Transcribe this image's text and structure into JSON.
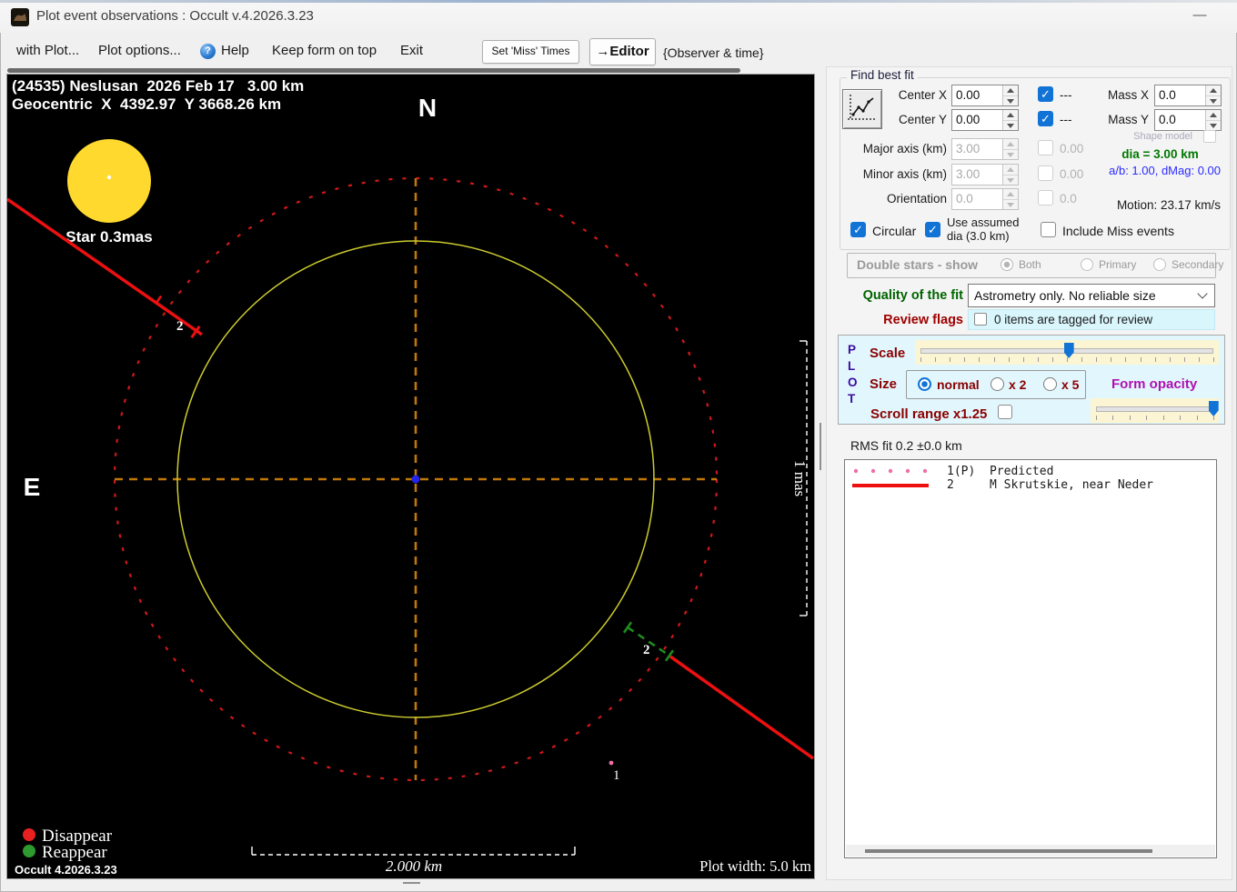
{
  "window": {
    "title": "Plot event observations : Occult v.4.2026.3.23",
    "minimize_glyph": "—"
  },
  "menubar": {
    "with_plot": "with Plot...",
    "plot_options": "Plot options...",
    "help": "Help",
    "keep_on_top": "Keep form on top",
    "exit": "Exit",
    "set_miss_times": "Set 'Miss' Times",
    "editor": "→Editor",
    "observer_time": "{Observer & time}"
  },
  "plot": {
    "header_line1": "(24535) Neslusan  2026 Feb 17   3.00 km",
    "header_line2": "Geocentric  X  4392.97  Y 3668.26 km",
    "north_label": "N",
    "east_label": "E",
    "star_label": "Star 0.3mas",
    "chord2_upper_label": "2",
    "chord2_lower_label": "2",
    "point1_label": "1",
    "legend_disappear": "Disappear",
    "legend_reappear": "Reappear",
    "version": "Occult 4.2026.3.23",
    "scale_bar_label": "2.000 km",
    "plot_width_label": "Plot width: 5.0 km",
    "mas_scale_label": "1 mas"
  },
  "find_best_fit": {
    "group_label": "Find best fit",
    "center_x_label": "Center X",
    "center_x_value": "0.00",
    "center_x_dash": "---",
    "center_y_label": "Center Y",
    "center_y_value": "0.00",
    "center_y_dash": "---",
    "mass_x_label": "Mass X",
    "mass_x_value": "0.0",
    "mass_y_label": "Mass Y",
    "mass_y_value": "0.0",
    "shape_model_label": "Shape model",
    "major_axis_label": "Major axis (km)",
    "major_axis_value": "3.00",
    "major_axis_alt": "0.00",
    "dia_label": "dia = 3.00 km",
    "minor_axis_label": "Minor axis (km)",
    "minor_axis_value": "3.00",
    "minor_axis_alt": "0.00",
    "ab_dmag_label": "a/b: 1.00, dMag: 0.00",
    "orientation_label": "Orientation",
    "orientation_value": "0.0",
    "orientation_alt": "0.0",
    "motion_label": "Motion: 23.17 km/s",
    "circular_label": "Circular",
    "use_assumed_line1": "Use assumed",
    "use_assumed_line2": "dia (3.0 km)",
    "include_miss_label": "Include Miss events"
  },
  "double_stars": {
    "label": "Double stars - show",
    "both": "Both",
    "primary": "Primary",
    "secondary": "Secondary"
  },
  "quality": {
    "label": "Quality of the fit",
    "value": "Astrometry only. No reliable size"
  },
  "review": {
    "label": "Review flags",
    "value": "0 items are tagged for review"
  },
  "plot_controls": {
    "plot_vertical": [
      "P",
      "L",
      "O",
      "T"
    ],
    "scale_label": "Scale",
    "size_label": "Size",
    "size_options": [
      "normal",
      "x 2",
      "x 5"
    ],
    "form_opacity_label": "Form opacity",
    "scroll_range_label": "Scroll range x1.25",
    "scale_percent": 49,
    "opacity_percent": 94
  },
  "rms": {
    "label": "RMS fit 0.2 ±0.0 km"
  },
  "observations": {
    "rows": [
      {
        "key": "1(P)",
        "name": "Predicted",
        "text": "1(P)  Predicted",
        "style": "dotted"
      },
      {
        "key": "2",
        "name": "M Skrutskie, near Neder",
        "text": "2     M Skrutskie, near Neder",
        "style": "solid"
      }
    ]
  },
  "colors": {
    "star": "#ffd92e",
    "asteroid_outline": "#cbcb2f",
    "uncertainty_circle": "#d01818",
    "crosshair": "#c07808",
    "center_dot": "#2424e8",
    "chord": "#ee1010",
    "reappear": "#1e8a1e",
    "disappear_dot": "#e82020",
    "reappear_dot": "#2e9b2e",
    "predicted_dotted": "#ef6fa8",
    "accent": "#1273d6"
  }
}
